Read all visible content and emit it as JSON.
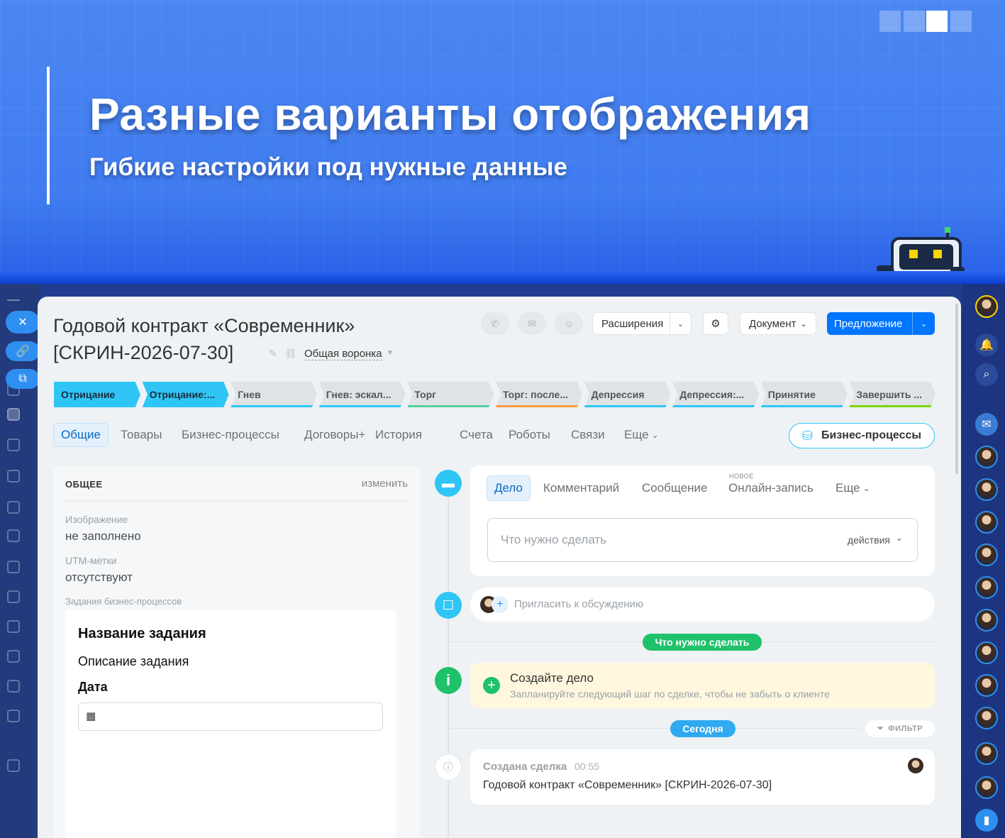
{
  "banner": {
    "title": "Разные варианты отображения",
    "subtitle": "Гибкие настройки под нужные данные"
  },
  "deal": {
    "title": "Годовой контракт «Современник» [СКРИН-2026-07-30]",
    "funnel": "Общая воронка"
  },
  "toolbar": {
    "extensions": "Расширения",
    "document": "Документ",
    "proposal": "Предложение"
  },
  "stages": [
    {
      "label": "Отрицание",
      "bg": "#2fc6f6",
      "color": "#1c2b3a",
      "line": "#2fc6f6"
    },
    {
      "label": "Отрицание:...",
      "bg": "#2fc6f6",
      "color": "#1c2b3a",
      "line": "#2fc6f6"
    },
    {
      "label": "Гнев",
      "bg": "#dfe3e6",
      "color": "#555",
      "line": "#2fc6f6"
    },
    {
      "label": "Гнев: эскал...",
      "bg": "#dfe3e6",
      "color": "#555",
      "line": "#2fc6f6"
    },
    {
      "label": "Торг",
      "bg": "#dfe3e6",
      "color": "#555",
      "line": "#55d0a0"
    },
    {
      "label": "Торг: после...",
      "bg": "#dfe3e6",
      "color": "#555",
      "line": "#ff9a3c"
    },
    {
      "label": "Депрессия",
      "bg": "#dfe3e6",
      "color": "#555",
      "line": "#2fc6f6"
    },
    {
      "label": "Депрессия:...",
      "bg": "#dfe3e6",
      "color": "#555",
      "line": "#2fc6f6"
    },
    {
      "label": "Принятие",
      "bg": "#dfe3e6",
      "color": "#555",
      "line": "#2fc6f6"
    },
    {
      "label": "Завершить ...",
      "bg": "#dfe3e6",
      "color": "#555",
      "line": "#7bd500"
    }
  ],
  "tabs": [
    "Общие",
    "Товары",
    "Бизнес-процессы",
    "Договоры+",
    "История",
    "Счета",
    "Роботы",
    "Связи",
    "Еще"
  ],
  "bp_button": "Бизнес-процессы",
  "general": {
    "section": "ОБЩЕЕ",
    "edit": "изменить",
    "image_label": "Изображение",
    "image_value": "не заполнено",
    "utm_label": "UTM-метки",
    "utm_value": "отсутствуют",
    "tasks_label": "Задания бизнес-процессов"
  },
  "task_form": {
    "name": "Название задания",
    "description": "Описание задания",
    "date_label": "Дата"
  },
  "timeline": {
    "tabs": [
      "Дело",
      "Комментарий",
      "Сообщение",
      "Онлайн-запись",
      "Еще"
    ],
    "new_badge": "НОВОЕ",
    "todo_placeholder": "Что нужно сделать",
    "actions": "действия",
    "invite": "Пригласить к обсуждению",
    "todo_badge": "Что нужно сделать",
    "create_title": "Создайте дело",
    "create_hint": "Запланируйте следующий шаг по сделке, чтобы не забыть о клиенте",
    "today_badge": "Сегодня",
    "filter": "ФИЛЬТР",
    "event_title": "Создана сделка",
    "event_time": "00:55",
    "event_text": "Годовой контракт «Современник» [СКРИН-2026-07-30]"
  }
}
